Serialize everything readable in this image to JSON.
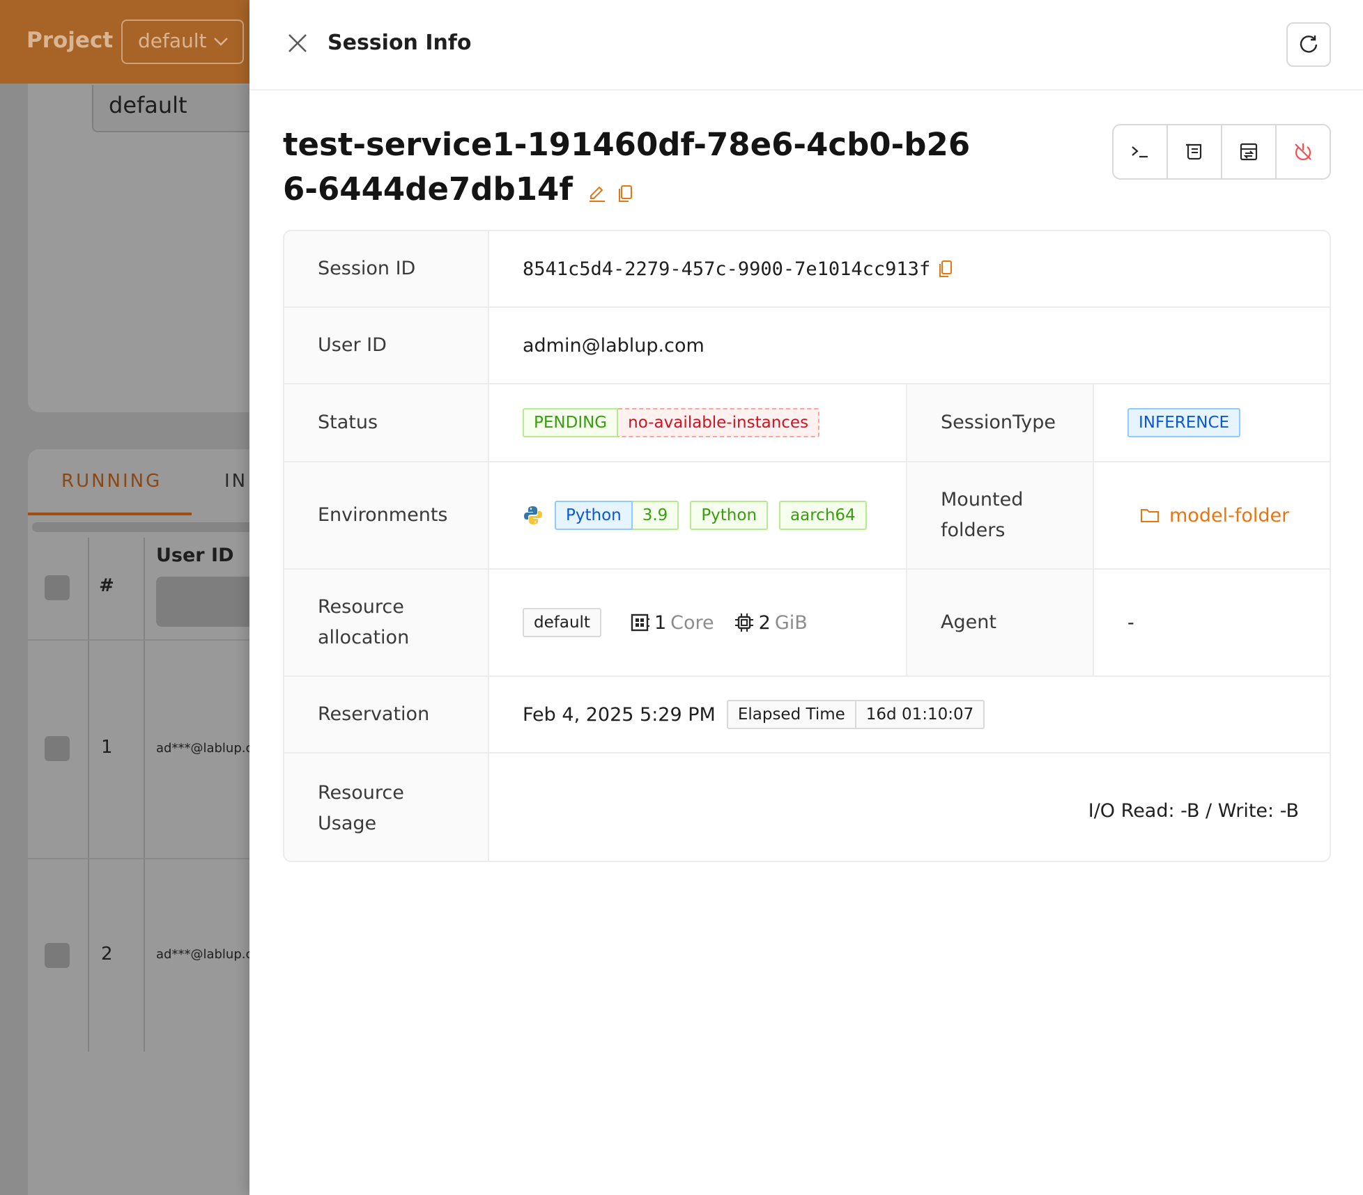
{
  "background": {
    "project_label": "Project",
    "project_select": "default",
    "default_field": "default",
    "tabs": [
      "RUNNING",
      "IN"
    ],
    "table": {
      "col_hash": "#",
      "col_user": "User ID",
      "rows": [
        {
          "num": "1",
          "email": "ad***@lablup.com"
        },
        {
          "num": "2",
          "email": "ad***@lablup.com"
        }
      ]
    }
  },
  "drawer": {
    "title": "Session Info",
    "session_name": "test-service1-191460df-78e6-4cb0-b266-6444de7db14f",
    "fields": {
      "session_id": {
        "label": "Session ID",
        "value": "8541c5d4-2279-457c-9900-7e1014cc913f"
      },
      "user_id": {
        "label": "User ID",
        "value": "admin@lablup.com"
      },
      "status": {
        "label": "Status",
        "value": "PENDING",
        "reason": "no-available-instances"
      },
      "session_type": {
        "label": "SessionType",
        "value": "INFERENCE"
      },
      "environments": {
        "label": "Environments",
        "lang": "Python",
        "version": "3.9",
        "tag1": "Python",
        "tag2": "aarch64"
      },
      "mounted_folders": {
        "label": "Mounted folders",
        "value": "model-folder"
      },
      "resource_allocation": {
        "label": "Resource allocation",
        "group": "default",
        "cpu_num": "1",
        "cpu_unit": "Core",
        "mem_num": "2",
        "mem_unit": "GiB"
      },
      "agent": {
        "label": "Agent",
        "value": "-"
      },
      "reservation": {
        "label": "Reservation",
        "date": "Feb 4, 2025 5:29 PM",
        "elapsed_label": "Elapsed Time",
        "elapsed_value": "16d 01:10:07"
      },
      "resource_usage": {
        "label": "Resource Usage",
        "io": "I/O Read: -B / Write: -B"
      }
    }
  },
  "colors": {
    "accent": "#e8750e",
    "header_bg": "#a86426"
  }
}
